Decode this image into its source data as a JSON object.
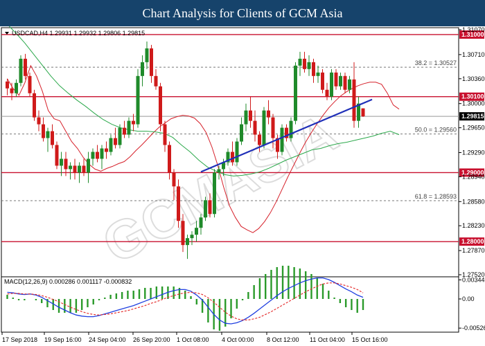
{
  "header": {
    "title": "Chart Analysis for Clients of GCM Asia"
  },
  "watermark": "GCMASIA",
  "colors": {
    "banner": "#16436b",
    "bull": "#1f8a2a",
    "bear": "#cf1a1a",
    "resistance": "#c8102e",
    "trendline": "#1f2fb8",
    "ma_red": "#d6202a",
    "ma_green": "#2aa84a",
    "macd_line": "#1f3fe0",
    "signal": "#e53030",
    "hist": "#2a9a2a"
  },
  "chart_data": [
    {
      "type": "candlestick",
      "title": "USDCAD,H4 1.29931 1.29932 1.29806 1.29815",
      "symbol": "USDCAD,H4",
      "ohlc_header": [
        "1.29931",
        "1.29932",
        "1.29806",
        "1.29815"
      ],
      "ylim": [
        1.2749,
        1.311
      ],
      "y_ticks": [
        "1.31070",
        "1.30710",
        "1.30360",
        "1.30000",
        "1.29650",
        "1.29290",
        "1.28940",
        "1.28580",
        "1.28230",
        "1.27870",
        "1.27520"
      ],
      "x_ticks": [
        "17 Sep 2018",
        "19 Sep 16:00",
        "24 Sep 04:00",
        "26 Sep 20:00",
        "1 Oct 08:00",
        "4 Oct 00:00",
        "8 Oct 12:00",
        "11 Oct 04:00",
        "15 Oct 16:00"
      ],
      "last_price": "1.29815",
      "horizontal_lines": [
        {
          "value": 1.31,
          "label": "1.31000",
          "style": "solid"
        },
        {
          "value": 1.301,
          "label": "1.30100",
          "style": "solid"
        },
        {
          "value": 1.29,
          "label": "1.29000",
          "style": "solid"
        },
        {
          "value": 1.28,
          "label": "1.28000",
          "style": "solid"
        }
      ],
      "fibonacci": [
        {
          "label": "38.2 = 1.30527",
          "value": 1.30527
        },
        {
          "label": "50.0 = 1.29560",
          "value": 1.2956
        },
        {
          "label": "61.8 = 1.28593",
          "value": 1.28593
        }
      ],
      "trendline": [
        {
          "bar": 43,
          "value": 1.2901
        },
        {
          "bar": 81,
          "value": 1.3006
        }
      ],
      "series": [
        {
          "values": [
            1.3036,
            1.3022,
            1.3012,
            1.303,
            1.3055,
            1.304,
            1.3018,
            1.299,
            1.2978,
            1.2975,
            1.296,
            1.2945,
            1.2935,
            1.2922,
            1.2912,
            1.2905,
            1.2902,
            1.2906,
            1.2909,
            1.2913,
            1.2916,
            1.2923,
            1.2932,
            1.294,
            1.2949,
            1.2958,
            1.2966,
            1.2972,
            1.2978,
            1.2981,
            1.2983,
            1.2982,
            1.2979,
            1.2971,
            1.2958,
            1.2937,
            1.291,
            1.2879,
            1.2852,
            1.2835,
            1.2822,
            1.2817,
            1.2813,
            1.2819,
            1.2829,
            1.2842,
            1.2858,
            1.2876,
            1.2894,
            1.2911,
            1.2928,
            1.2944,
            1.2958,
            1.2971,
            1.2983,
            1.2994,
            1.3003,
            1.3011,
            1.3017,
            1.3022,
            1.3026,
            1.3029,
            1.3031,
            1.3031,
            1.3028,
            1.3015,
            1.2998,
            1.2992
          ]
        },
        {
          "values": [
            1.3115,
            1.3102,
            1.3088,
            1.3072,
            1.3056,
            1.304,
            1.3026,
            1.3015,
            1.3005,
            1.2996,
            1.2986,
            1.2977,
            1.297,
            1.2965,
            1.2962,
            1.296,
            1.296,
            1.2959,
            1.2957,
            1.2951,
            1.294,
            1.293,
            1.2918,
            1.2908,
            1.2902,
            1.2897,
            1.2895,
            1.2896,
            1.2898,
            1.2901,
            1.2906,
            1.2912,
            1.2918,
            1.2923,
            1.2928,
            1.2933,
            1.2935,
            1.2939,
            1.2942,
            1.2944,
            1.2947,
            1.295,
            1.2953,
            1.2957,
            1.296,
            1.2955
          ]
        }
      ],
      "candles": [
        [
          1.3032,
          1.3036,
          1.3012,
          1.3022
        ],
        [
          1.3022,
          1.303,
          1.3005,
          1.3015
        ],
        [
          1.3015,
          1.3035,
          1.301,
          1.303
        ],
        [
          1.303,
          1.307,
          1.3025,
          1.3065
        ],
        [
          1.3065,
          1.3072,
          1.3035,
          1.304
        ],
        [
          1.304,
          1.3045,
          1.301,
          1.3015
        ],
        [
          1.3015,
          1.302,
          1.2975,
          1.298
        ],
        [
          1.298,
          1.299,
          1.296,
          1.297
        ],
        [
          1.297,
          1.298,
          1.2945,
          1.295
        ],
        [
          1.295,
          1.2965,
          1.293,
          1.296
        ],
        [
          1.296,
          1.297,
          1.2935,
          1.294
        ],
        [
          1.294,
          1.2945,
          1.2905,
          1.291
        ],
        [
          1.291,
          1.293,
          1.2895,
          1.292
        ],
        [
          1.292,
          1.293,
          1.2895,
          1.2905
        ],
        [
          1.2905,
          1.2915,
          1.289,
          1.291
        ],
        [
          1.291,
          1.292,
          1.289,
          1.29
        ],
        [
          1.29,
          1.2915,
          1.2885,
          1.291
        ],
        [
          1.291,
          1.292,
          1.2895,
          1.29
        ],
        [
          1.29,
          1.293,
          1.2885,
          1.292
        ],
        [
          1.292,
          1.2935,
          1.291,
          1.293
        ],
        [
          1.293,
          1.294,
          1.2915,
          1.292
        ],
        [
          1.292,
          1.294,
          1.2905,
          1.2935
        ],
        [
          1.2935,
          1.2945,
          1.292,
          1.293
        ],
        [
          1.293,
          1.2955,
          1.2925,
          1.295
        ],
        [
          1.295,
          1.2965,
          1.2935,
          1.294
        ],
        [
          1.294,
          1.297,
          1.2935,
          1.2965
        ],
        [
          1.2965,
          1.2975,
          1.295,
          1.2955
        ],
        [
          1.2955,
          1.298,
          1.295,
          1.2975
        ],
        [
          1.2975,
          1.2985,
          1.296,
          1.297
        ],
        [
          1.297,
          1.305,
          1.2965,
          1.304
        ],
        [
          1.304,
          1.307,
          1.3025,
          1.306
        ],
        [
          1.306,
          1.309,
          1.305,
          1.308
        ],
        [
          1.308,
          1.3085,
          1.303,
          1.304
        ],
        [
          1.304,
          1.305,
          1.302,
          1.3025
        ],
        [
          1.3025,
          1.303,
          1.296,
          1.297
        ],
        [
          1.297,
          1.2975,
          1.293,
          1.294
        ],
        [
          1.294,
          1.2945,
          1.289,
          1.29
        ],
        [
          1.29,
          1.2905,
          1.286,
          1.288
        ],
        [
          1.288,
          1.289,
          1.282,
          1.283
        ],
        [
          1.283,
          1.284,
          1.2785,
          1.2795
        ],
        [
          1.2795,
          1.281,
          1.2775,
          1.2805
        ],
        [
          1.2805,
          1.2815,
          1.2795,
          1.281
        ],
        [
          1.281,
          1.283,
          1.28,
          1.282
        ],
        [
          1.282,
          1.284,
          1.281,
          1.2835
        ],
        [
          1.2835,
          1.2865,
          1.283,
          1.286
        ],
        [
          1.286,
          1.287,
          1.2835,
          1.284
        ],
        [
          1.284,
          1.2905,
          1.2835,
          1.29
        ],
        [
          1.29,
          1.291,
          1.289,
          1.2905
        ],
        [
          1.2905,
          1.292,
          1.2895,
          1.2915
        ],
        [
          1.2915,
          1.2935,
          1.291,
          1.293
        ],
        [
          1.293,
          1.2945,
          1.291,
          1.2915
        ],
        [
          1.2915,
          1.295,
          1.291,
          1.2945
        ],
        [
          1.2945,
          1.298,
          1.294,
          1.297
        ],
        [
          1.297,
          1.3,
          1.296,
          1.299
        ],
        [
          1.299,
          1.301,
          1.2965,
          1.2975
        ],
        [
          1.2975,
          1.299,
          1.2945,
          1.2955
        ],
        [
          1.2955,
          1.296,
          1.293,
          1.294
        ],
        [
          1.294,
          1.2995,
          1.2935,
          1.299
        ],
        [
          1.299,
          1.3005,
          1.297,
          1.298
        ],
        [
          1.298,
          1.2985,
          1.2935,
          1.295
        ],
        [
          1.295,
          1.2955,
          1.292,
          1.293
        ],
        [
          1.293,
          1.297,
          1.2925,
          1.2965
        ],
        [
          1.2965,
          1.297,
          1.2945,
          1.295
        ],
        [
          1.295,
          1.298,
          1.2945,
          1.2975
        ],
        [
          1.2975,
          1.306,
          1.297,
          1.3055
        ],
        [
          1.3055,
          1.3075,
          1.304,
          1.3065
        ],
        [
          1.3065,
          1.3075,
          1.3045,
          1.305
        ],
        [
          1.305,
          1.307,
          1.304,
          1.306
        ],
        [
          1.306,
          1.3065,
          1.303,
          1.304
        ],
        [
          1.304,
          1.3055,
          1.303,
          1.3045
        ],
        [
          1.3045,
          1.305,
          1.3015,
          1.302
        ],
        [
          1.302,
          1.303,
          1.3005,
          1.301
        ],
        [
          1.301,
          1.305,
          1.3005,
          1.3045
        ],
        [
          1.3045,
          1.305,
          1.302,
          1.3025
        ],
        [
          1.3025,
          1.3045,
          1.302,
          1.304
        ],
        [
          1.304,
          1.3045,
          1.3015,
          1.302
        ],
        [
          1.302,
          1.304,
          1.3015,
          1.3035
        ],
        [
          1.3035,
          1.306,
          1.2965,
          1.2975
        ],
        [
          1.2975,
          1.301,
          1.2965,
          1.3
        ],
        [
          1.29931,
          1.29932,
          1.29806,
          1.29815
        ]
      ]
    },
    {
      "type": "macd",
      "title": "MACD(12,26,9) 0.000286 0.001117 -0.000832",
      "header_values": [
        "0.000286",
        "0.001117",
        "-0.000832"
      ],
      "ylim": [
        -0.006,
        0.004
      ],
      "y_ticks": [
        "0.003446",
        "0.00",
        "-0.005267"
      ],
      "series": [
        {
          "name": "MACD",
          "values": [
            0.0012,
            0.0011,
            0.0009,
            0.0008,
            0.0009,
            0.0007,
            0.0003,
            -0.0003,
            -0.0009,
            -0.0015,
            -0.002,
            -0.0025,
            -0.0029,
            -0.0031,
            -0.0032,
            -0.0032,
            -0.003,
            -0.0027,
            -0.0024,
            -0.0021,
            -0.0018,
            -0.0015,
            -0.0012,
            -0.0008,
            -0.0004,
            0.0,
            0.0004,
            0.0008,
            0.0012,
            0.0015,
            0.0017,
            0.0017,
            0.0014,
            0.0007,
            -0.0002,
            -0.0015,
            -0.0028,
            -0.0038,
            -0.0044,
            -0.0045,
            -0.0043,
            -0.0039,
            -0.0033,
            -0.0026,
            -0.0018,
            -0.001,
            -0.0002,
            0.0006,
            0.0013,
            0.0019,
            0.0024,
            0.0029,
            0.0033,
            0.0036,
            0.0038,
            0.0038,
            0.0035,
            0.003,
            0.0024,
            0.0018,
            0.0013,
            0.0007,
            0.0003
          ]
        },
        {
          "name": "Signal",
          "values": [
            0.0009,
            0.001,
            0.001,
            0.0009,
            0.0009,
            0.0008,
            0.0006,
            0.0003,
            -0.0001,
            -0.0005,
            -0.001,
            -0.0015,
            -0.0019,
            -0.0023,
            -0.0026,
            -0.0028,
            -0.0029,
            -0.0028,
            -0.0027,
            -0.0025,
            -0.0023,
            -0.0021,
            -0.0018,
            -0.0015,
            -0.0012,
            -0.0008,
            -0.0005,
            -0.0001,
            0.0003,
            0.0006,
            0.0009,
            0.0011,
            0.0012,
            0.0011,
            0.0008,
            0.0002,
            -0.0006,
            -0.0015,
            -0.0024,
            -0.0031,
            -0.0036,
            -0.0038,
            -0.0038,
            -0.0036,
            -0.0033,
            -0.0028,
            -0.0023,
            -0.0017,
            -0.0011,
            -0.0005,
            0.0001,
            0.0007,
            0.0013,
            0.0018,
            0.0023,
            0.0027,
            0.0029,
            0.0029,
            0.0027,
            0.0024,
            0.0021,
            0.0017,
            0.0011
          ]
        }
      ]
    }
  ]
}
